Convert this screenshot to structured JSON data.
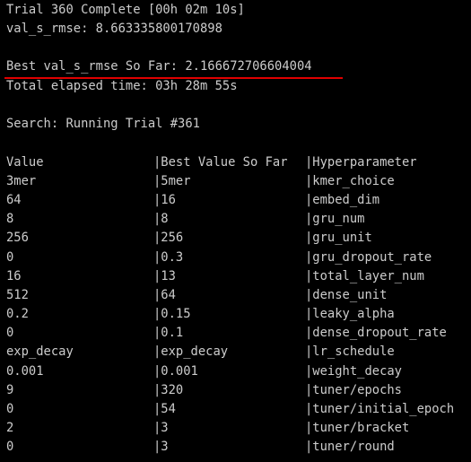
{
  "header": {
    "trial_complete": "Trial 360 Complete [00h 02m 10s]",
    "val_metric": "val_s_rmse: 8.663335800170898",
    "best_so_far": "Best val_s_rmse So Far: 2.166672706604004",
    "elapsed": "Total elapsed time: 03h 28m 55s",
    "search_status": "Search: Running Trial #361"
  },
  "highlight_color": "#e00000",
  "table": {
    "columns": [
      "Value",
      "|Best Value So Far",
      "|Hyperparameter"
    ],
    "rows": [
      [
        "3mer",
        "|5mer",
        "|kmer_choice"
      ],
      [
        "64",
        "|16",
        "|embed_dim"
      ],
      [
        "8",
        "|8",
        "|gru_num"
      ],
      [
        "256",
        "|256",
        "|gru_unit"
      ],
      [
        "0",
        "|0.3",
        "|gru_dropout_rate"
      ],
      [
        "16",
        "|13",
        "|total_layer_num"
      ],
      [
        "512",
        "|64",
        "|dense_unit"
      ],
      [
        "0.2",
        "|0.15",
        "|leaky_alpha"
      ],
      [
        "0",
        "|0.1",
        "|dense_dropout_rate"
      ],
      [
        "exp_decay",
        "|exp_decay",
        "|lr_schedule"
      ],
      [
        "0.001",
        "|0.001",
        "|weight_decay"
      ],
      [
        "9",
        "|320",
        "|tuner/epochs"
      ],
      [
        "0",
        "|54",
        "|tuner/initial_epoch"
      ],
      [
        "2",
        "|3",
        "|tuner/bracket"
      ],
      [
        "0",
        "|3",
        "|tuner/round"
      ]
    ]
  }
}
